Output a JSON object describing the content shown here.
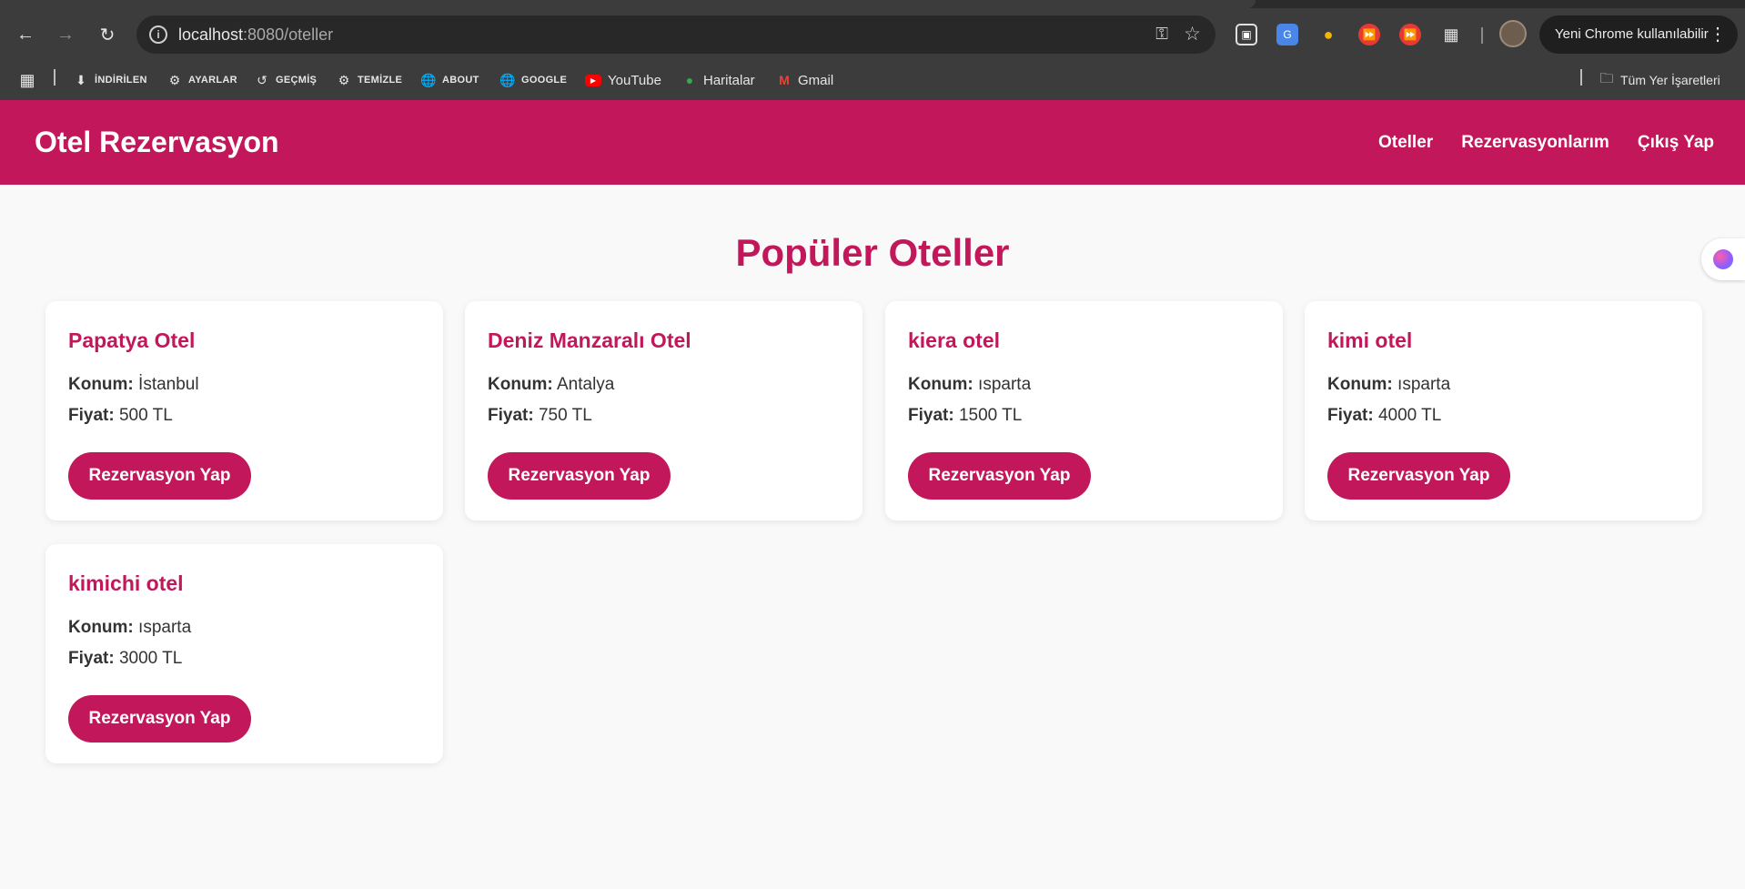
{
  "browser": {
    "url_host": "localhost",
    "url_path": ":8080/oteller",
    "update_label": "Yeni Chrome kullanılabilir",
    "bookmarks": [
      {
        "label": "İNDİRİLEN",
        "icon": "download-icon"
      },
      {
        "label": "AYARLAR",
        "icon": "gear-icon"
      },
      {
        "label": "GEÇMİŞ",
        "icon": "history-icon"
      },
      {
        "label": "TEMİZLE",
        "icon": "gear-icon"
      },
      {
        "label": "ABOUT",
        "icon": "globe-icon"
      },
      {
        "label": "GOOGLE",
        "icon": "globe-icon"
      },
      {
        "label": "YouTube",
        "icon": "youtube-icon"
      },
      {
        "label": "Haritalar",
        "icon": "maps-icon"
      },
      {
        "label": "Gmail",
        "icon": "gmail-icon"
      }
    ],
    "all_bookmarks_label": "Tüm Yer İşaretleri"
  },
  "site": {
    "brand": "Otel Rezervasyon",
    "nav": [
      "Oteller",
      "Rezervasyonlarım",
      "Çıkış Yap"
    ],
    "accent_color": "#c2185b"
  },
  "main": {
    "title": "Popüler Oteller",
    "location_label": "Konum:",
    "price_label": "Fiyat:",
    "button_label": "Rezervasyon Yap",
    "hotels": [
      {
        "name": "Papatya Otel",
        "location": "İstanbul",
        "price": "500 TL"
      },
      {
        "name": "Deniz Manzaralı Otel",
        "location": "Antalya",
        "price": "750 TL"
      },
      {
        "name": "kiera otel",
        "location": "ısparta",
        "price": "1500 TL"
      },
      {
        "name": "kimi otel",
        "location": "ısparta",
        "price": "4000 TL"
      },
      {
        "name": "kimichi otel",
        "location": "ısparta",
        "price": "3000 TL"
      }
    ]
  }
}
